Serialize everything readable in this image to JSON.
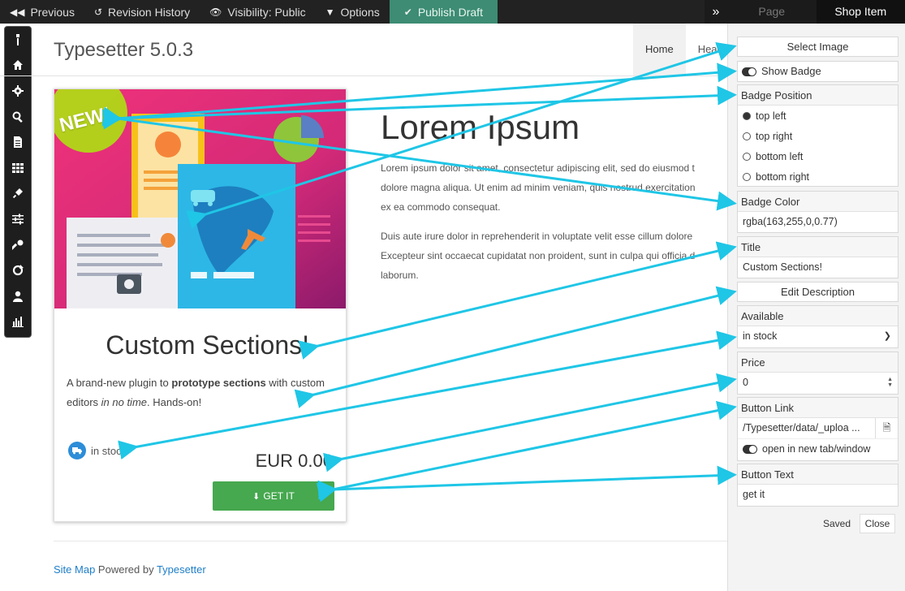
{
  "toolbar": {
    "previous": "Previous",
    "revision_history": "Revision History",
    "visibility": "Visibility: Public",
    "options": "Options",
    "publish": "Publish Draft",
    "tab_page": "Page",
    "tab_shop_item": "Shop Item"
  },
  "site": {
    "title": "Typesetter 5.0.3",
    "nav": [
      "Home",
      "Headi"
    ]
  },
  "card": {
    "badge": "NEW!",
    "title": "Custom Sections!",
    "desc_1": "A brand-new plugin to ",
    "desc_bold": "prototype sections",
    "desc_2": " with custom editors ",
    "desc_italic": "in no time",
    "desc_3": ". Hands-on!",
    "availability": "in stock",
    "price": "EUR 0.00",
    "button": "GET IT"
  },
  "content": {
    "heading": "Lorem Ipsum",
    "p1": [
      "Lorem ipsum dolor sit amet, consectetur adipiscing elit, sed do eiusmod t",
      "dolore magna aliqua. Ut enim ad minim veniam, quis nostrud exercitation",
      "ex ea commodo consequat."
    ],
    "p2": [
      "Duis aute irure dolor in reprehenderit in voluptate velit esse cillum dolore",
      "Excepteur sint occaecat cupidatat non proident, sunt in culpa qui officia d",
      "laborum."
    ]
  },
  "footer": {
    "sitemap": "Site Map",
    "powered": " Powered by ",
    "link": "Typesetter"
  },
  "panel": {
    "select_image": "Select Image",
    "show_badge": "Show Badge",
    "badge_position_label": "Badge Position",
    "positions": [
      "top left",
      "top right",
      "bottom left",
      "bottom right"
    ],
    "badge_color_label": "Badge Color",
    "badge_color_value": "rgba(163,255,0,0.77)",
    "title_label": "Title",
    "title_value": "Custom Sections!",
    "edit_description": "Edit Description",
    "available_label": "Available",
    "available_value": "in stock",
    "price_label": "Price",
    "price_value": "0",
    "button_link_label": "Button Link",
    "button_link_value": "/Typesetter/data/_uploa ...",
    "open_new_tab": "open in new tab/window",
    "button_text_label": "Button Text",
    "button_text_value": "get it",
    "saved": "Saved",
    "close": "Close"
  },
  "colors": {
    "arrow": "#1fc6e6",
    "publish_bg": "#3d8c73",
    "button_green": "#46a84f",
    "badge_green": "#a3ff00"
  }
}
